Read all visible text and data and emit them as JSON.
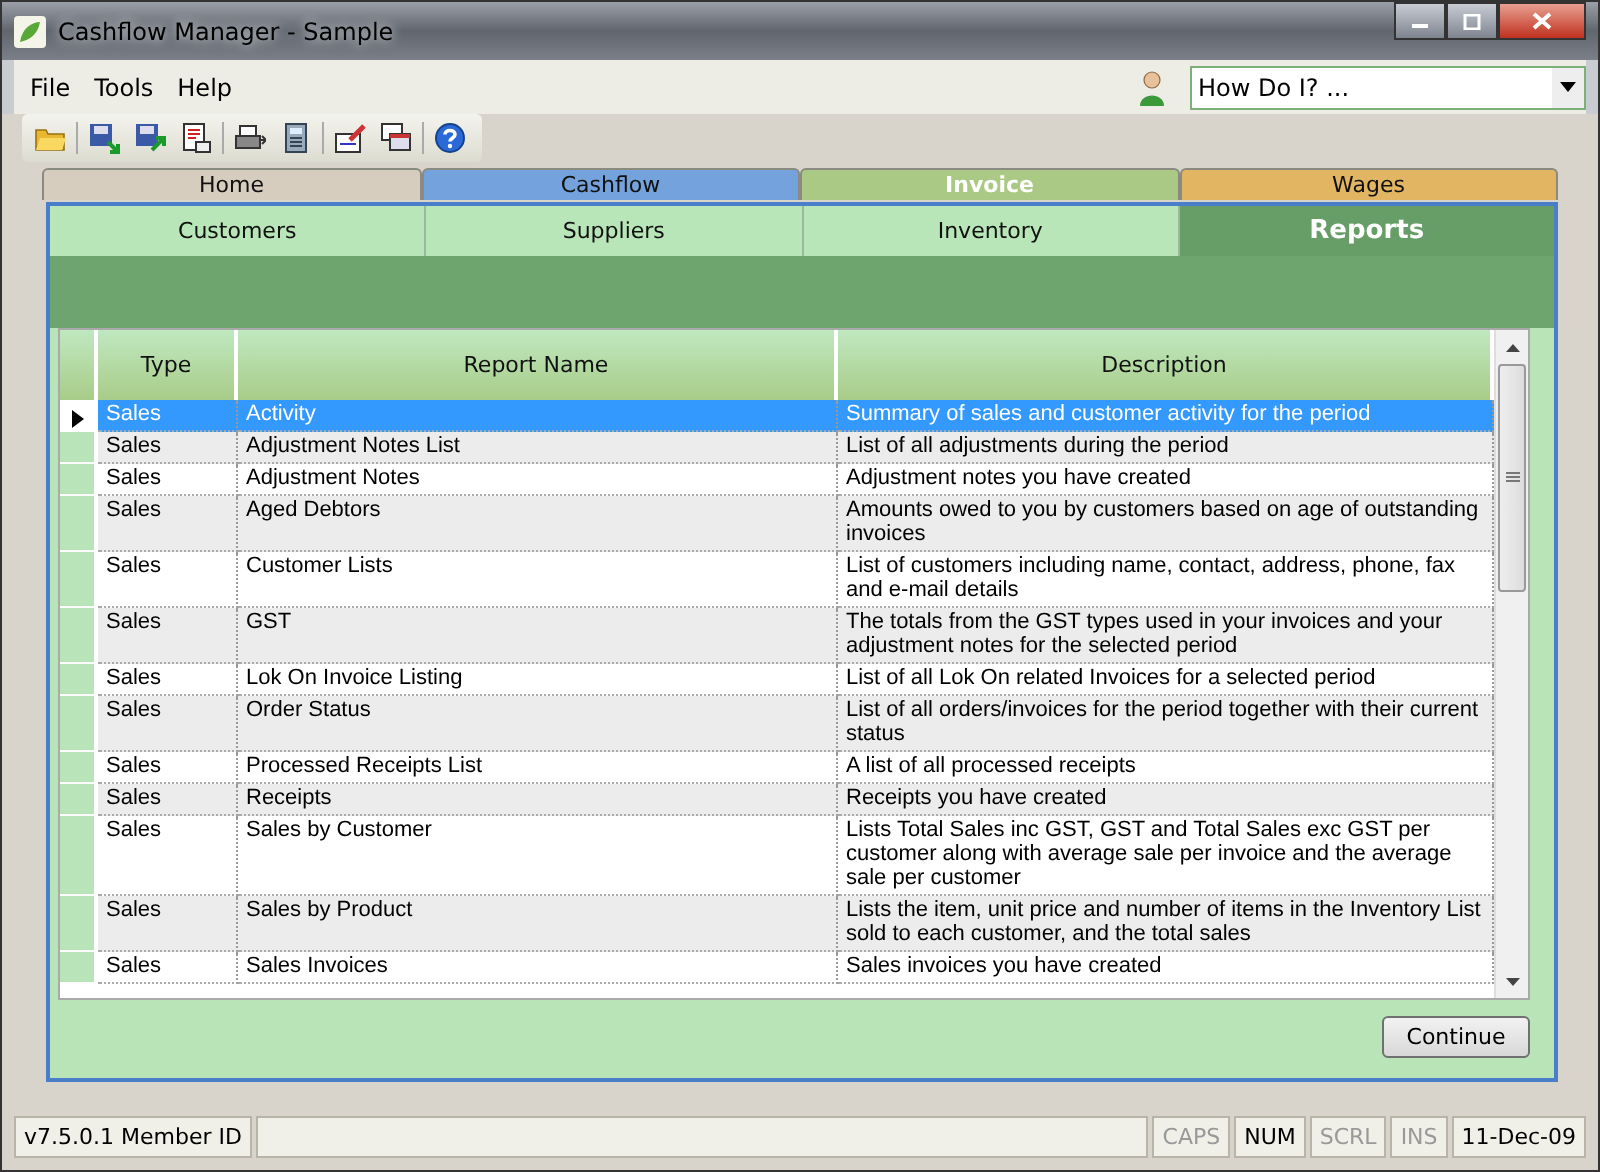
{
  "window": {
    "title": "Cashflow Manager - Sample"
  },
  "menu": [
    {
      "label": "File"
    },
    {
      "label": "Tools"
    },
    {
      "label": "Help"
    }
  ],
  "help_box": {
    "value": "How Do I? ..."
  },
  "main_tabs": [
    {
      "label": "Home",
      "selected": false,
      "color": "#d6cdbf"
    },
    {
      "label": "Cashflow",
      "selected": false,
      "color": "#74a2dc"
    },
    {
      "label": "Invoice",
      "selected": true,
      "color": "#a9c985"
    },
    {
      "label": "Wages",
      "selected": false,
      "color": "#e2b563"
    }
  ],
  "sub_tabs": [
    {
      "label": "Customers",
      "selected": false
    },
    {
      "label": "Suppliers",
      "selected": false
    },
    {
      "label": "Inventory",
      "selected": false
    },
    {
      "label": "Reports",
      "selected": true
    }
  ],
  "table": {
    "columns": [
      "Type",
      "Report Name",
      "Description"
    ],
    "rows": [
      {
        "type": "Sales",
        "name": "Activity",
        "description": "Summary of sales and customer activity for the period",
        "selected": true
      },
      {
        "type": "Sales",
        "name": "Adjustment Notes List",
        "description": "List of all adjustments during the period",
        "selected": false
      },
      {
        "type": "Sales",
        "name": "Adjustment Notes",
        "description": "Adjustment notes you have created",
        "selected": false
      },
      {
        "type": "Sales",
        "name": "Aged Debtors",
        "description": "Amounts owed to you by customers based on age of outstanding invoices",
        "selected": false
      },
      {
        "type": "Sales",
        "name": "Customer Lists",
        "description": "List of customers including name, contact, address, phone, fax and e-mail details",
        "selected": false
      },
      {
        "type": "Sales",
        "name": "GST",
        "description": "The totals from the GST types used in your invoices and your adjustment notes for the selected period",
        "selected": false
      },
      {
        "type": "Sales",
        "name": "Lok On Invoice Listing",
        "description": "List of all Lok On related Invoices for a selected period",
        "selected": false
      },
      {
        "type": "Sales",
        "name": "Order Status",
        "description": "List of all orders/invoices for the period together with their current status",
        "selected": false
      },
      {
        "type": "Sales",
        "name": "Processed Receipts List",
        "description": "A list of all processed receipts",
        "selected": false
      },
      {
        "type": "Sales",
        "name": "Receipts",
        "description": "Receipts you have created",
        "selected": false
      },
      {
        "type": "Sales",
        "name": "Sales by Customer",
        "description": "Lists Total Sales inc GST, GST and Total Sales exc GST per customer along with average sale per invoice and the average sale per customer",
        "selected": false
      },
      {
        "type": "Sales",
        "name": "Sales by Product",
        "description": "Lists the item, unit price and number of items in the Inventory List sold to each customer, and the total sales",
        "selected": false
      },
      {
        "type": "Sales",
        "name": "Sales Invoices",
        "description": "Sales invoices you have created",
        "selected": false
      }
    ]
  },
  "continue_button": "Continue",
  "status_bar": [
    {
      "text": "v7.5.0.1 Member ID",
      "kind": "text"
    },
    {
      "kind": "blank"
    },
    {
      "text": "CAPS",
      "kind": "key",
      "on": false
    },
    {
      "text": "NUM",
      "kind": "key",
      "on": true
    },
    {
      "text": "SCRL",
      "kind": "key",
      "on": false
    },
    {
      "text": "INS",
      "kind": "key",
      "on": false
    },
    {
      "text": "11-Dec-09",
      "kind": "text"
    }
  ]
}
